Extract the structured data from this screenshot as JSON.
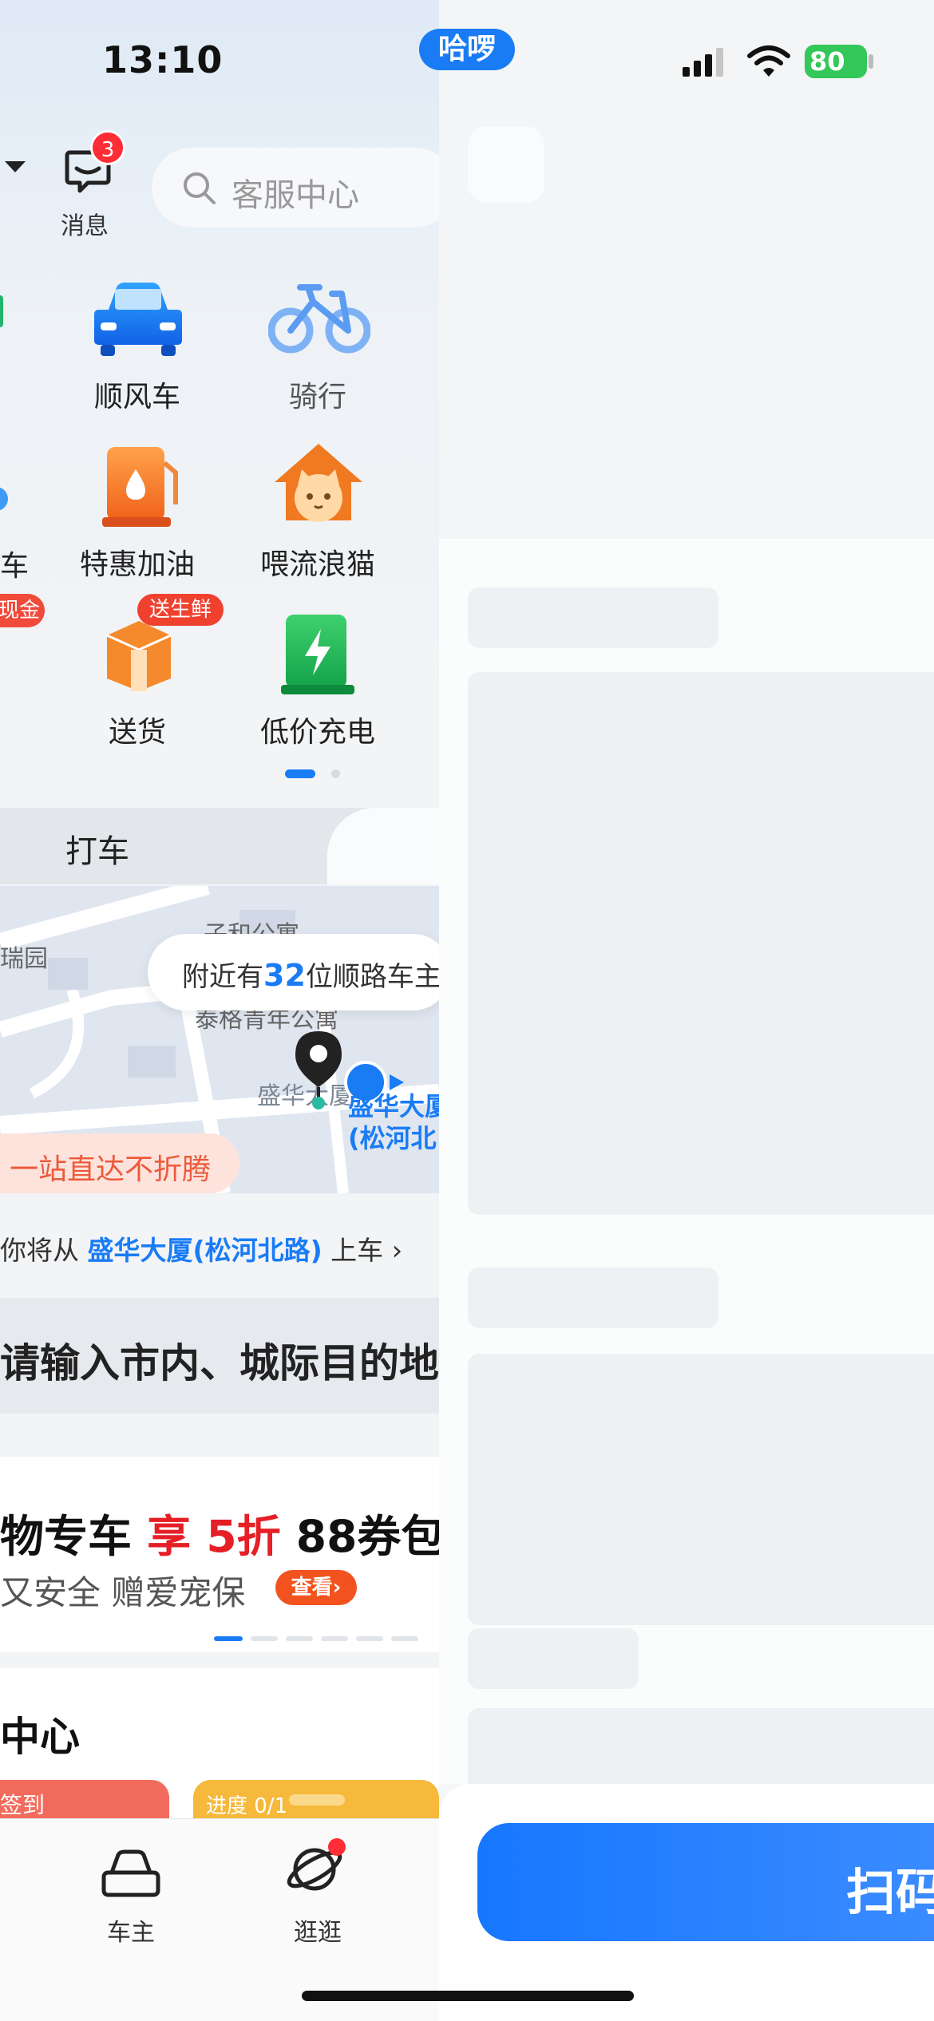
{
  "status_bar": {
    "time": "13:10",
    "carrier_pill": "哈啰",
    "battery": "80"
  },
  "header": {
    "message_label": "消息",
    "message_badge": "3",
    "search_placeholder": "客服中心"
  },
  "services": [
    {
      "label": "顺风车",
      "icon": "car-icon"
    },
    {
      "label": "骑行",
      "icon": "bike-icon"
    },
    {
      "label": "车",
      "icon": "car-partial-icon"
    },
    {
      "label": "特惠加油",
      "icon": "fuel-icon"
    },
    {
      "label": "喂流浪猫",
      "icon": "cat-house-icon"
    },
    {
      "label": "送货",
      "icon": "package-icon",
      "tag": "送生鲜"
    },
    {
      "label": "低价充电",
      "icon": "charging-icon"
    }
  ],
  "partial_tag_cash": "现金",
  "tab_taxi": "打车",
  "map": {
    "labels": [
      "瑞园",
      "子和公寓",
      "泰格青年公寓",
      "盛华大厦",
      "盛华大厦",
      "(松河北"
    ],
    "nearby_prefix": "附近有",
    "nearby_count": "32",
    "nearby_suffix": "位顺路车主",
    "promo_tag": "一站直达不折腾"
  },
  "pickup": {
    "prefix": "你将从",
    "location": "盛华大厦(松河北路)",
    "suffix": "上车"
  },
  "destination_placeholder": "请输入市内、城际目的地",
  "banner": {
    "title_prefix": "物专车",
    "title_highlight_1": "享",
    "title_highlight_2": "5",
    "title_highlight_3": "折",
    "title_suffix": "88券包",
    "subtitle": "又安全 赠爱宠保",
    "view_button": "查看"
  },
  "section": {
    "title": "中心",
    "card_red": "签到",
    "card_yellow": "进度 0/1"
  },
  "tabbar": [
    {
      "label": "车主",
      "icon": "car-outline-icon"
    },
    {
      "label": "逛逛",
      "icon": "planet-icon"
    }
  ],
  "right_panel": {
    "scan_button": "扫码"
  },
  "colors": {
    "accent": "#1a7cf5",
    "badge": "#ff2d36",
    "promo_red": "#e51f26"
  }
}
